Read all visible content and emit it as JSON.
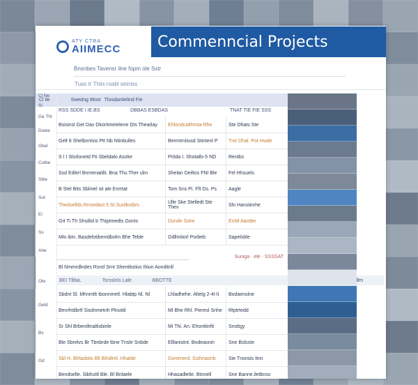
{
  "banner": {
    "title": "Commenncial Projects"
  },
  "logo": {
    "small": "ATY CTRA",
    "big": "AIIMECC"
  },
  "header": {
    "line1": "Bnsnbes Tavensr ilne fopm ole Sstr",
    "line2": "Tuas tr Thiis roabl seiniss"
  },
  "table": {
    "head": [
      "Cl ile",
      "Swedng Wost",
      "Tlosdantielind Fie"
    ],
    "columns": [
      "RSS SDDE I IE.BS",
      "DBBAS ESBDAS",
      "TNAT TIE FIE SSS"
    ],
    "rows": [
      [
        "Bsisinsl Get Dav Dkoritmetelene Dts Thearlay",
        "Ehlondcalthrnta Rhe",
        "Ste Dhats Ste"
      ],
      [
        "Gelt 8 Shelbnnlsis Ptt Nb Ntinbulles",
        "Bermtrnitusd Stintenl P",
        "Tne Dhal. Pot Hsale"
      ],
      [
        "S I I Slorlonetd Fti Sbeldalo Asoke",
        "Pritda I. Shotalls-5 ND",
        "Rentbs"
      ],
      [
        "Ssd Edlerl Bnmenaitlit. Bna Thu Ther ulm",
        "Shelan Deiltos FNI Ble",
        "Fel Hhsuels"
      ],
      [
        "B Stel Bits Sblmel sit ale Enrrtat",
        "Tom Sns Pi. Fft Ds. Ps",
        "Aagle"
      ],
      [
        "Thedsellds Rrmedast 5 St Sunlbntbm",
        "Ulle Ske Stelledt Ste Thev",
        "Shi Hanstinrhe"
      ],
      [
        "Grt Ti Th Shsillol b Thiptmedts Gonts",
        "Dunde Sshe",
        "Enttil Aantbe"
      ],
      [
        "Mlo ibin. Basdelotibenidbolm Bhe Teble",
        "Gdllmtiorl Porbeb",
        "Sapelsble"
      ]
    ],
    "midbar_more": "Suniga · ele · SSSSAT",
    "section_line": "Bl Nmmrdlndes Rsnd Srnt Shentitutios Ihiun Aonditnll",
    "subhead": [
      "BEI TlltlaL",
      "Tsrsslnls Lale",
      "BBOTTE",
      "Mestabelan Fllrn"
    ],
    "rows2": [
      [
        "Sbdnt Sl. Mhnmtlt tbonnmetl. Hlabtp Nl. Nl",
        "Lhladhehe. Altelg 2-4I-li",
        "Bodaenslne"
      ],
      [
        "Benrhtdbrtf Sisdnmetnh Plnuttil",
        "Ml Bhe Rhl. Pieresl Snhe",
        "Rtptrtedd"
      ],
      [
        "Sr Shl Brbeniltnaltisbinle",
        "Mi Thi. An. Ehonttinfit",
        "Snsttgy"
      ],
      [
        "Ble Sbrelvs Br Tbnbrde tbne Tnsle Snbde",
        "Elllanistnt. Bndeasnin",
        "Sne Bslsste"
      ],
      [
        "Sbl H. Blrlaobits Bll Bihdlrel. Hhalde",
        "Gommerd. Ssthnaonb",
        "Sie Tnsnsis Itnn"
      ],
      [
        "Bendselle. Sibhuttl Ble. Bl Bnlaele",
        "Hhasadletle. Btnnell",
        "Sne Banne.iletbnss"
      ]
    ]
  },
  "left_labels": [
    "Cl Ne",
    "Sl",
    "Ga Thl",
    "Dulee",
    "Gbel",
    "Cutbe",
    "Sibe",
    "Sut",
    "Ei",
    "Ss",
    "Ahe",
    "Ote",
    "Geld",
    "Bs",
    "Gd"
  ]
}
